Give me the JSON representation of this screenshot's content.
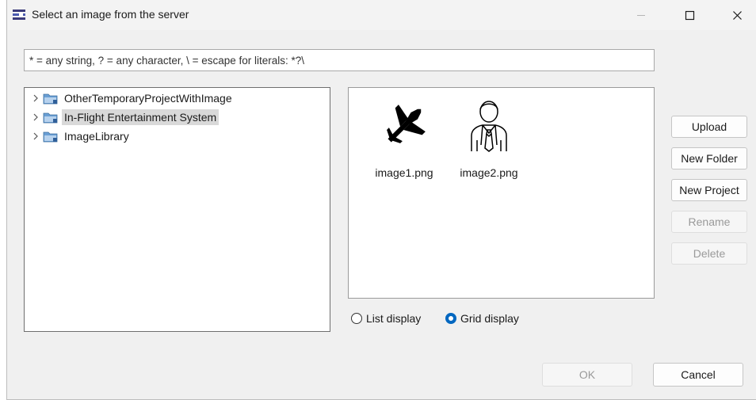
{
  "window": {
    "title": "Select an image from the server",
    "app_icon": "dialog-app-icon",
    "controls": [
      "minimize-icon",
      "maximize-icon",
      "close-icon"
    ]
  },
  "filter": {
    "value": "* = any string, ? = any character, \\ = escape for literals: *?\\"
  },
  "tree": {
    "items": [
      {
        "label": "OtherTemporaryProjectWithImage",
        "icon": "project-folder-icon",
        "selected": false
      },
      {
        "label": "In-Flight Entertainment System",
        "icon": "project-folder-icon",
        "selected": true
      },
      {
        "label": "ImageLibrary",
        "icon": "project-folder-icon",
        "selected": false
      }
    ]
  },
  "grid": {
    "items": [
      {
        "name": "image1.png",
        "icon": "airplane-icon"
      },
      {
        "name": "image2.png",
        "icon": "businessman-icon"
      }
    ]
  },
  "display_mode": {
    "options": [
      {
        "label": "List display",
        "checked": false
      },
      {
        "label": "Grid display",
        "checked": true
      }
    ]
  },
  "actions": {
    "upload": "Upload",
    "new_folder": "New Folder",
    "new_project": "New Project",
    "rename": "Rename",
    "delete": "Delete"
  },
  "footer": {
    "ok": "OK",
    "cancel": "Cancel"
  },
  "colors": {
    "accent": "#0067c0",
    "selection": "#d9d9d9",
    "folder": "#6a9fd4",
    "dialog_bg": "#f0f0f0"
  }
}
